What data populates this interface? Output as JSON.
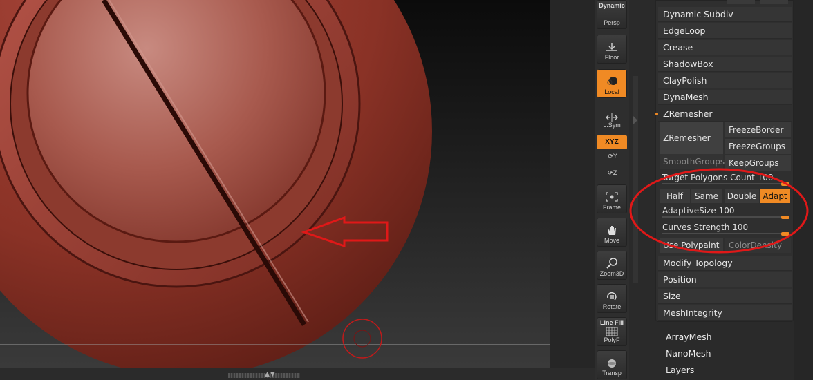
{
  "shelf": {
    "persp": {
      "top": "Dynamic",
      "label": "Persp"
    },
    "floor": {
      "label": "Floor"
    },
    "local": {
      "label": "Local"
    },
    "lsym": {
      "label": "L.Sym"
    },
    "xyz": {
      "label": "XYZ"
    },
    "rot_y": "Y",
    "rot_z": "Z",
    "frame": {
      "label": "Frame"
    },
    "move": {
      "label": "Move"
    },
    "zoom3d": {
      "label": "Zoom3D"
    },
    "rotate": {
      "label": "Rotate"
    },
    "polyf": {
      "top": "Line Fill",
      "label": "PolyF"
    },
    "transp": {
      "label": "Transp"
    }
  },
  "palette": {
    "items_top": [
      "Dynamic Subdiv",
      "EdgeLoop",
      "Crease",
      "ShadowBox",
      "ClayPolish",
      "DynaMesh"
    ],
    "zremesher": {
      "header": "ZRemesher",
      "button": "ZRemesher",
      "freeze_border": "FreezeBorder",
      "freeze_groups": "FreezeGroups",
      "smooth_groups": "SmoothGroups",
      "keep_groups": "KeepGroups",
      "target_polygons": {
        "label": "Target Polygons Count",
        "value": "100"
      },
      "modes": {
        "half": "Half",
        "same": "Same",
        "double": "Double",
        "adapt": "Adapt",
        "selected": "Adapt"
      },
      "adaptive_size": {
        "label": "AdaptiveSize",
        "value": "100"
      },
      "curves_strength": {
        "label": "Curves Strength",
        "value": "100"
      },
      "use_polypaint": "Use Polypaint",
      "color_density": "ColorDensity"
    },
    "items_bottom": [
      "Modify Topology",
      "Position",
      "Size",
      "MeshIntegrity"
    ]
  },
  "below_palette": [
    "ArrayMesh",
    "NanoMesh",
    "Layers"
  ],
  "colors": {
    "accent": "#f08a24",
    "annotation": "#e01818",
    "model": "#8a3226"
  }
}
